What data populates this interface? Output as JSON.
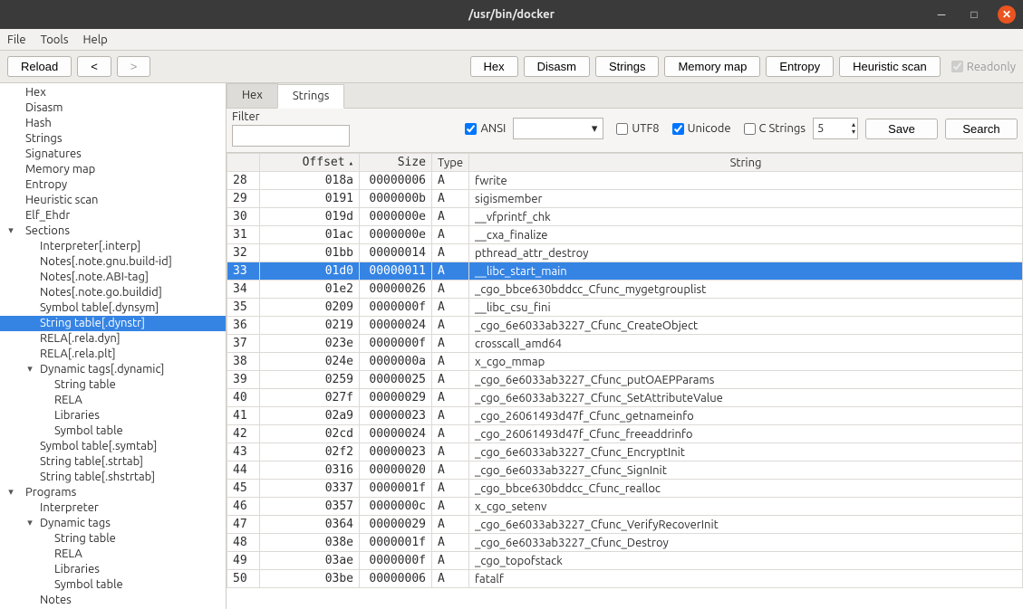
{
  "window": {
    "title": "/usr/bin/docker"
  },
  "menubar": [
    "File",
    "Tools",
    "Help"
  ],
  "toolbar": {
    "reload": "Reload",
    "back": "<",
    "forward": ">",
    "views": [
      "Hex",
      "Disasm",
      "Strings",
      "Memory map",
      "Entropy",
      "Heuristic scan"
    ],
    "readonly_label": "Readonly",
    "readonly_checked": true
  },
  "tree": [
    {
      "label": "Hex",
      "depth": 1
    },
    {
      "label": "Disasm",
      "depth": 1
    },
    {
      "label": "Hash",
      "depth": 1
    },
    {
      "label": "Strings",
      "depth": 1
    },
    {
      "label": "Signatures",
      "depth": 1
    },
    {
      "label": "Memory map",
      "depth": 1
    },
    {
      "label": "Entropy",
      "depth": 1
    },
    {
      "label": "Heuristic scan",
      "depth": 1
    },
    {
      "label": "Elf_Ehdr",
      "depth": 1
    },
    {
      "label": "Sections",
      "depth": 1,
      "expandable": true
    },
    {
      "label": "Interpreter[.interp]",
      "depth": 2
    },
    {
      "label": "Notes[.note.gnu.build-id]",
      "depth": 2
    },
    {
      "label": "Notes[.note.ABI-tag]",
      "depth": 2
    },
    {
      "label": "Notes[.note.go.buildid]",
      "depth": 2
    },
    {
      "label": "Symbol table[.dynsym]",
      "depth": 2
    },
    {
      "label": "String table[.dynstr]",
      "depth": 2,
      "selected": true
    },
    {
      "label": "RELA[.rela.dyn]",
      "depth": 2
    },
    {
      "label": "RELA[.rela.plt]",
      "depth": 2
    },
    {
      "label": "Dynamic tags[.dynamic]",
      "depth": 2,
      "expandable": true
    },
    {
      "label": "String table",
      "depth": 3
    },
    {
      "label": "RELA",
      "depth": 3
    },
    {
      "label": "Libraries",
      "depth": 3
    },
    {
      "label": "Symbol table",
      "depth": 3
    },
    {
      "label": "Symbol table[.symtab]",
      "depth": 2
    },
    {
      "label": "String table[.strtab]",
      "depth": 2
    },
    {
      "label": "String table[.shstrtab]",
      "depth": 2
    },
    {
      "label": "Programs",
      "depth": 1,
      "expandable": true
    },
    {
      "label": "Interpreter",
      "depth": 2
    },
    {
      "label": "Dynamic tags",
      "depth": 2,
      "expandable": true
    },
    {
      "label": "String table",
      "depth": 3
    },
    {
      "label": "RELA",
      "depth": 3
    },
    {
      "label": "Libraries",
      "depth": 3
    },
    {
      "label": "Symbol table",
      "depth": 3
    },
    {
      "label": "Notes",
      "depth": 2
    }
  ],
  "tabs": [
    {
      "label": "Hex",
      "active": false
    },
    {
      "label": "Strings",
      "active": true
    }
  ],
  "filter": {
    "label": "Filter",
    "value": "",
    "ansi": {
      "label": "ANSI",
      "checked": true
    },
    "combo_value": "",
    "utf8": {
      "label": "UTF8",
      "checked": false
    },
    "unicode": {
      "label": "Unicode",
      "checked": true
    },
    "cstrings": {
      "label": "C Strings",
      "checked": false
    },
    "spin_value": "5",
    "save": "Save",
    "search": "Search"
  },
  "columns": [
    "",
    "Offset",
    "Size",
    "Type",
    "String"
  ],
  "rows": [
    {
      "i": "28",
      "offset": "018a",
      "size": "00000006",
      "type": "A",
      "str": "fwrite"
    },
    {
      "i": "29",
      "offset": "0191",
      "size": "0000000b",
      "type": "A",
      "str": "sigismember"
    },
    {
      "i": "30",
      "offset": "019d",
      "size": "0000000e",
      "type": "A",
      "str": "__vfprintf_chk"
    },
    {
      "i": "31",
      "offset": "01ac",
      "size": "0000000e",
      "type": "A",
      "str": "__cxa_finalize"
    },
    {
      "i": "32",
      "offset": "01bb",
      "size": "00000014",
      "type": "A",
      "str": "pthread_attr_destroy"
    },
    {
      "i": "33",
      "offset": "01d0",
      "size": "00000011",
      "type": "A",
      "str": "__libc_start_main",
      "sel": true
    },
    {
      "i": "34",
      "offset": "01e2",
      "size": "00000026",
      "type": "A",
      "str": "_cgo_bbce630bddcc_Cfunc_mygetgrouplist"
    },
    {
      "i": "35",
      "offset": "0209",
      "size": "0000000f",
      "type": "A",
      "str": "__libc_csu_fini"
    },
    {
      "i": "36",
      "offset": "0219",
      "size": "00000024",
      "type": "A",
      "str": "_cgo_6e6033ab3227_Cfunc_CreateObject"
    },
    {
      "i": "37",
      "offset": "023e",
      "size": "0000000f",
      "type": "A",
      "str": "crosscall_amd64"
    },
    {
      "i": "38",
      "offset": "024e",
      "size": "0000000a",
      "type": "A",
      "str": "x_cgo_mmap"
    },
    {
      "i": "39",
      "offset": "0259",
      "size": "00000025",
      "type": "A",
      "str": "_cgo_6e6033ab3227_Cfunc_putOAEPParams"
    },
    {
      "i": "40",
      "offset": "027f",
      "size": "00000029",
      "type": "A",
      "str": "_cgo_6e6033ab3227_Cfunc_SetAttributeValue"
    },
    {
      "i": "41",
      "offset": "02a9",
      "size": "00000023",
      "type": "A",
      "str": "_cgo_26061493d47f_Cfunc_getnameinfo"
    },
    {
      "i": "42",
      "offset": "02cd",
      "size": "00000024",
      "type": "A",
      "str": "_cgo_26061493d47f_Cfunc_freeaddrinfo"
    },
    {
      "i": "43",
      "offset": "02f2",
      "size": "00000023",
      "type": "A",
      "str": "_cgo_6e6033ab3227_Cfunc_EncryptInit"
    },
    {
      "i": "44",
      "offset": "0316",
      "size": "00000020",
      "type": "A",
      "str": "_cgo_6e6033ab3227_Cfunc_SignInit"
    },
    {
      "i": "45",
      "offset": "0337",
      "size": "0000001f",
      "type": "A",
      "str": "_cgo_bbce630bddcc_Cfunc_realloc"
    },
    {
      "i": "46",
      "offset": "0357",
      "size": "0000000c",
      "type": "A",
      "str": "x_cgo_setenv"
    },
    {
      "i": "47",
      "offset": "0364",
      "size": "00000029",
      "type": "A",
      "str": "_cgo_6e6033ab3227_Cfunc_VerifyRecoverInit"
    },
    {
      "i": "48",
      "offset": "038e",
      "size": "0000001f",
      "type": "A",
      "str": "_cgo_6e6033ab3227_Cfunc_Destroy"
    },
    {
      "i": "49",
      "offset": "03ae",
      "size": "0000000f",
      "type": "A",
      "str": "_cgo_topofstack"
    },
    {
      "i": "50",
      "offset": "03be",
      "size": "00000006",
      "type": "A",
      "str": "fatalf"
    }
  ]
}
